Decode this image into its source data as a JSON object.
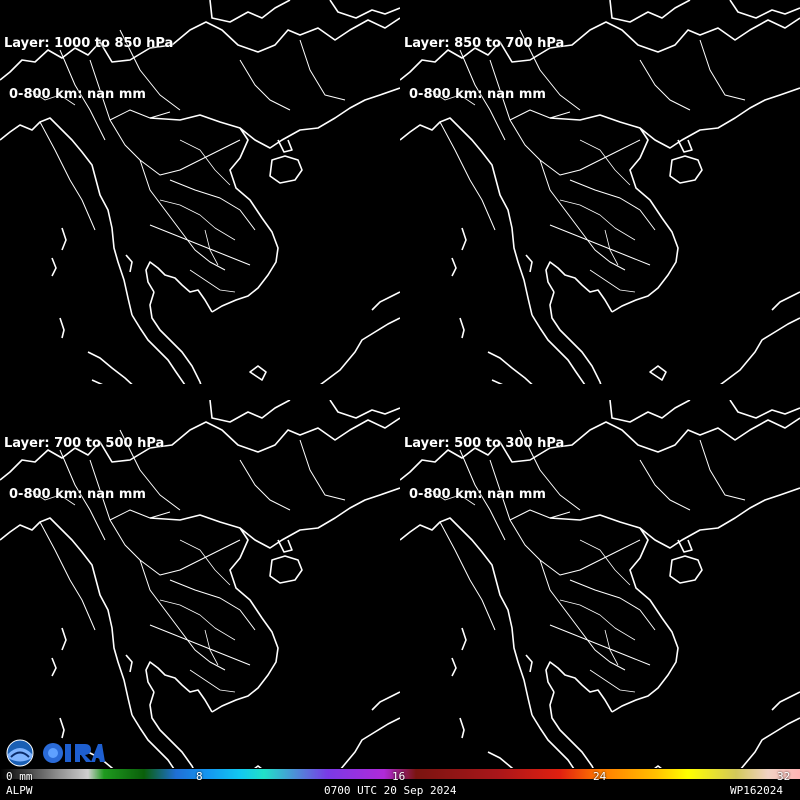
{
  "panels": [
    {
      "layer": "Layer: 1000 to 850 hPa",
      "sub": "0-800 km: nan mm"
    },
    {
      "layer": "Layer: 850 to 700 hPa",
      "sub": "0-800 km: nan mm"
    },
    {
      "layer": "Layer: 700 to 500 hPa",
      "sub": "0-800 km: nan mm"
    },
    {
      "layer": "Layer: 500 to 300 hPa",
      "sub": "0-800 km: nan mm"
    }
  ],
  "colorbar": {
    "ticks": [
      "0 mm",
      "8",
      "16",
      "24",
      "32"
    ],
    "product": "ALPW",
    "time": "0700 UTC 20 Sep 2024",
    "storm_id": "WP162024"
  },
  "logos": {
    "noaa": "NOAA",
    "cira": "CIRA"
  },
  "colors": {
    "background": "#000000",
    "coastline": "#ffffff"
  }
}
